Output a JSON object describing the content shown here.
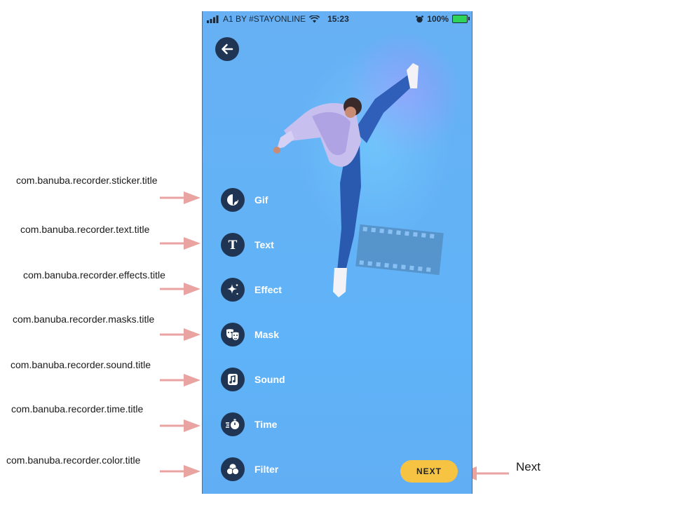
{
  "status_bar": {
    "carrier": "A1 BY #STAYONLINE",
    "time": "15:23",
    "battery": "100%"
  },
  "tools": [
    {
      "key": "sticker",
      "label": "Gif",
      "icon": "sticker-icon"
    },
    {
      "key": "text",
      "label": "Text",
      "icon": "text-icon"
    },
    {
      "key": "effects",
      "label": "Effect",
      "icon": "sparkle-icon"
    },
    {
      "key": "masks",
      "label": "Mask",
      "icon": "masks-icon"
    },
    {
      "key": "sound",
      "label": "Sound",
      "icon": "music-note-icon"
    },
    {
      "key": "time",
      "label": "Time",
      "icon": "stopwatch-icon"
    },
    {
      "key": "color",
      "label": "Filter",
      "icon": "filter-icon"
    }
  ],
  "annotations": [
    "com.banuba.recorder.sticker.title",
    "com.banuba.recorder.text.title",
    "com.banuba.recorder.effects.title",
    "com.banuba.recorder.masks.title",
    "com.banuba.recorder.sound.title",
    "com.banuba.recorder.time.title",
    "com.banuba.recorder.color.title"
  ],
  "next_button": {
    "label": "NEXT"
  },
  "next_annotation": "Next",
  "colors": {
    "background": "#64b2f6",
    "icon_circle": "#1f3553",
    "next_button": "#f7c342",
    "arrow": "#e9a3a1"
  }
}
